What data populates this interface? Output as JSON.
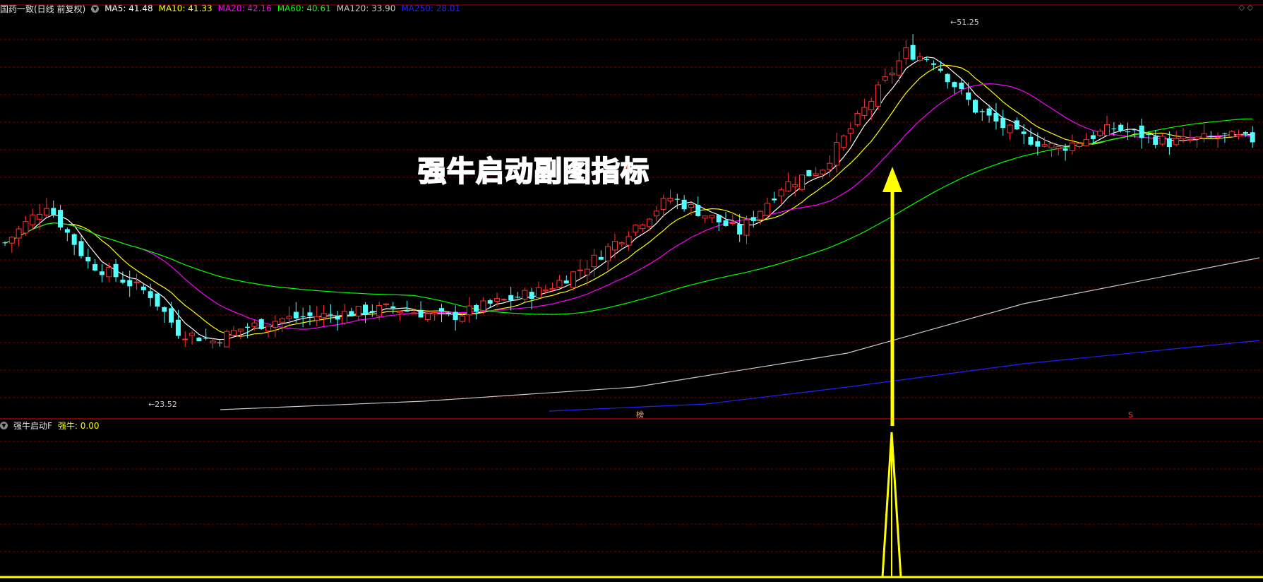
{
  "main_chart": {
    "stock_name": "国药一致(日线 前复权)",
    "ma_items": [
      {
        "label": "MA5: 41.48",
        "color": "#ffffff"
      },
      {
        "label": "MA10: 41.33",
        "color": "#ffff00"
      },
      {
        "label": "MA20: 42.16",
        "color": "#ff00ff"
      },
      {
        "label": "MA60: 40.61",
        "color": "#00ff00"
      },
      {
        "label": "MA120: 33.90",
        "color": "#c8c8c8"
      },
      {
        "label": "MA250: 28.01",
        "color": "#2222ff"
      }
    ],
    "high_label": "51.25",
    "low_label": "23.52",
    "marker_1": "榜",
    "marker_2": "S"
  },
  "banner_text": "强牛启动副图指标",
  "sub_chart": {
    "name": "强牛启动F",
    "value_label": "强牛: 0.00"
  },
  "colors": {
    "up": "#ff3232",
    "down": "#54ffff",
    "grid": "#7a0000",
    "signal": "#ffff00"
  },
  "icons": [
    "collapse-icon",
    "restore-icon"
  ]
}
